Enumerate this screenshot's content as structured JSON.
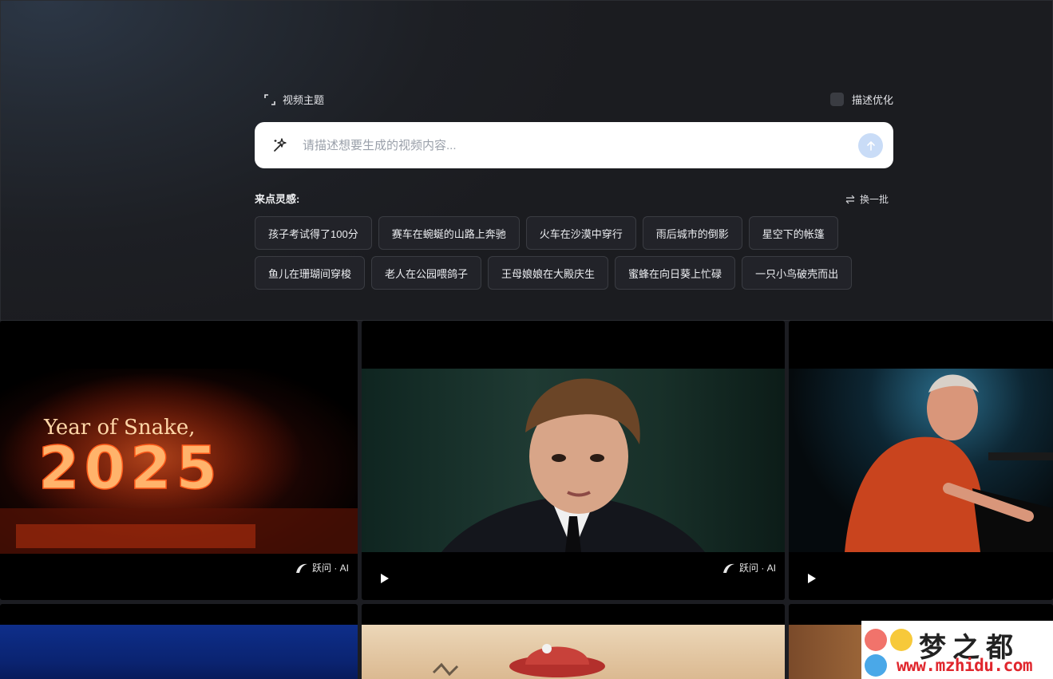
{
  "header": {
    "topic_label": "视频主题",
    "optimize_label": "描述优化"
  },
  "search": {
    "placeholder": "请描述想要生成的视频内容..."
  },
  "inspiration": {
    "title": "来点灵感:",
    "refresh_label": "换一批",
    "row1": [
      "孩子考试得了100分",
      "赛车在蜿蜒的山路上奔驰",
      "火车在沙漠中穿行",
      "雨后城市的倒影",
      "星空下的帐篷"
    ],
    "row2": [
      "鱼儿在珊瑚间穿梭",
      "老人在公园喂鸽子",
      "王母娘娘在大殿庆生",
      "蜜蜂在向日葵上忙碌",
      "一只小鸟破壳而出"
    ]
  },
  "gallery": {
    "watermark": "跃问 · AI",
    "card1_text_top": "Year of Snake,",
    "card1_text_big": "2025"
  },
  "site_logo": {
    "name": "梦之都",
    "url": "www.mzhidu.com"
  },
  "colors": {
    "accent_send": "#c9dcf7",
    "logo_red": "#e0262d"
  }
}
